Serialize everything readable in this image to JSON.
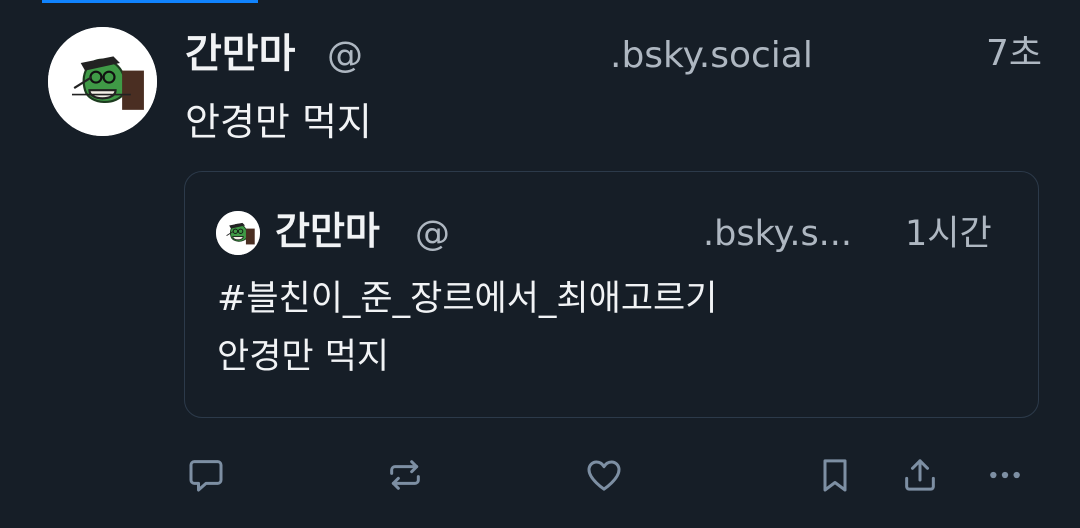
{
  "post": {
    "author": "간만마",
    "handle_at": "@",
    "handle_domain": ".bsky.social",
    "time": "7초",
    "text": "안경만 먹지"
  },
  "quote": {
    "author": "간만마",
    "handle_at": "@",
    "handle_domain": ".bsky.s...",
    "time": "1시간",
    "lines": [
      "#블친이_준_장르에서_최애고르기",
      "안경만 먹지"
    ]
  },
  "actions": {
    "icons": [
      "reply-icon",
      "repost-icon",
      "like-icon",
      "bookmark-icon",
      "share-icon",
      "more-icon"
    ],
    "color": "#7d8fa3"
  },
  "colors": {
    "background": "#161e27",
    "text": "#f1f3f5",
    "muted": "#aeb7c1",
    "accent": "#1083fe",
    "card_border": "#2c3a4a"
  }
}
